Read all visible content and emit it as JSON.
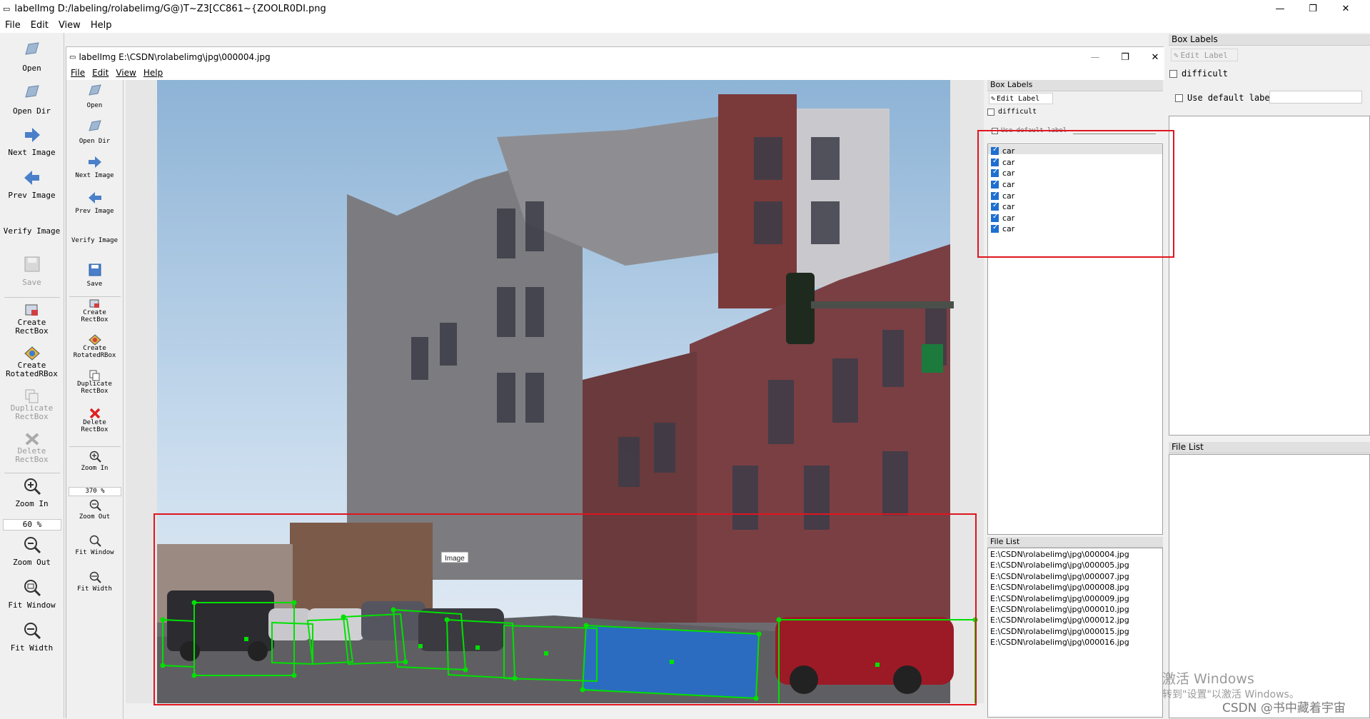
{
  "outer": {
    "title": "labelImg D:/labeling/rolabelimg/G@)T~Z3[CC861~{ZOOLR0DI.png",
    "menu": [
      "File",
      "Edit",
      "View",
      "Help"
    ],
    "minimize": "—",
    "maximize": "❐",
    "close": "✕"
  },
  "outer_toolbar": {
    "open": "Open",
    "open_dir": "Open Dir",
    "next_image": "Next Image",
    "prev_image": "Prev Image",
    "verify_image": "Verify Image",
    "save": "Save",
    "create_rectbox": "Create\nRectBox",
    "create_rotatedrbox": "Create\nRotatedRBox",
    "duplicate_rectbox": "Duplicate\nRectBox",
    "delete_rectbox": "Delete\nRectBox",
    "zoom_in": "Zoom In",
    "zoom_value": "60 %",
    "zoom_out": "Zoom Out",
    "fit_window": "Fit Window",
    "fit_width": "Fit Width"
  },
  "inner": {
    "title": "labelImg E:\\CSDN\\rolabelimg\\jpg\\000004.jpg",
    "menu": [
      "File",
      "Edit",
      "View",
      "Help"
    ],
    "minimize": "—",
    "maximize": "❐",
    "close": "✕",
    "toolbar": {
      "open": "Open",
      "open_dir": "Open Dir",
      "next_image": "Next Image",
      "prev_image": "Prev Image",
      "verify_image": "Verify Image",
      "save": "Save",
      "create_rectbox": "Create\nRectBox",
      "create_rotatedrbox": "Create\nRotatedRBox",
      "duplicate_rectbox": "Duplicate\nRectBox",
      "delete_rectbox": "Delete\nRectBox",
      "zoom_in": "Zoom In",
      "zoom_value": "370 %",
      "zoom_out": "Zoom Out",
      "fit_window": "Fit Window",
      "fit_width": "Fit Width"
    },
    "box_labels_title": "Box Labels",
    "edit_label": "Edit Label",
    "difficult": "difficult",
    "use_default_label": "Use default label",
    "labels": [
      "car",
      "car",
      "car",
      "car",
      "car",
      "car",
      "car",
      "car"
    ],
    "file_list_title": "File List",
    "files": [
      "E:\\CSDN\\rolabelimg\\jpg\\000004.jpg",
      "E:\\CSDN\\rolabelimg\\jpg\\000005.jpg",
      "E:\\CSDN\\rolabelimg\\jpg\\000007.jpg",
      "E:\\CSDN\\rolabelimg\\jpg\\000008.jpg",
      "E:\\CSDN\\rolabelimg\\jpg\\000009.jpg",
      "E:\\CSDN\\rolabelimg\\jpg\\000010.jpg",
      "E:\\CSDN\\rolabelimg\\jpg\\000012.jpg",
      "E:\\CSDN\\rolabelimg\\jpg\\000015.jpg",
      "E:\\CSDN\\rolabelimg\\jpg\\000016.jpg"
    ],
    "image_tooltip": "Image"
  },
  "outer_right": {
    "box_labels_title": "Box Labels",
    "edit_label": "Edit Label",
    "difficult": "difficult",
    "use_default_label": "Use default label",
    "file_list_title": "File List"
  },
  "watermark": {
    "activate_title": "激活 Windows",
    "activate_sub": "转到\"设置\"以激活 Windows。",
    "csdn": "CSDN @书中藏着宇宙"
  },
  "colors": {
    "annotation_green": "#00e000",
    "highlight_red": "#e0151f",
    "selected_fill": "#1e6fd8"
  }
}
